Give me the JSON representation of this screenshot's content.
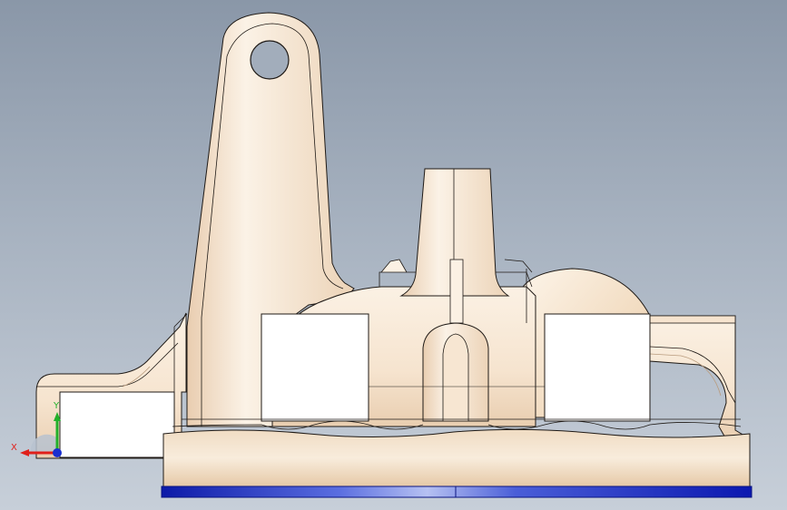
{
  "triad": {
    "x_label": "X",
    "y_label": "Y",
    "x_color": "#e0201a",
    "y_color": "#22b02a",
    "z_color": "#1a2fd0"
  },
  "colors": {
    "background_top": "#8a97a8",
    "background_bottom": "#c7cfd9",
    "part_fill": "#f6e4cf",
    "part_shade": "#e7c9a6",
    "edge": "#1f1a16",
    "base_stripe": "#0f1ec0"
  },
  "icons": {
    "triad": "coordinate-triad-icon"
  }
}
